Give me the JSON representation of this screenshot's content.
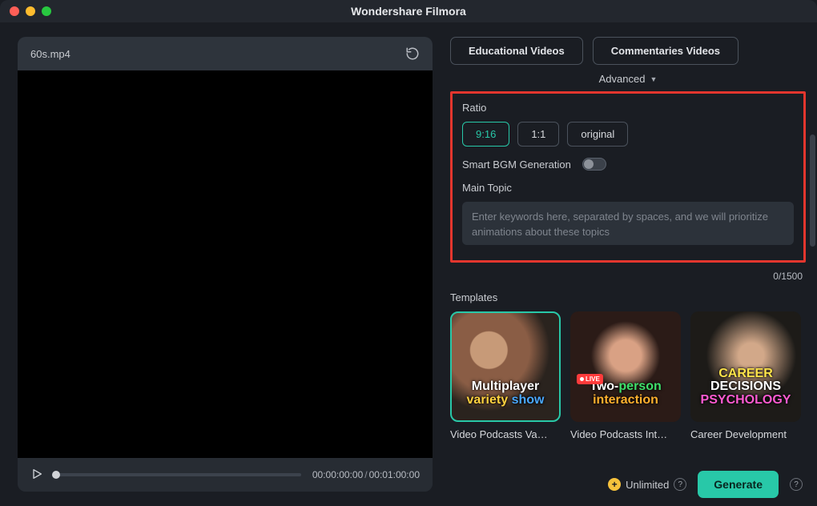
{
  "app": {
    "title": "Wondershare Filmora"
  },
  "video": {
    "filename": "60s.mp4",
    "current_time": "00:00:00:00",
    "total_time": "00:01:00:00"
  },
  "chips": {
    "educational": "Educational Videos",
    "commentaries": "Commentaries Videos"
  },
  "advanced_label": "Advanced",
  "ratio": {
    "label": "Ratio",
    "opt_916": "9:16",
    "opt_11": "1:1",
    "opt_orig": "original",
    "active": "9:16"
  },
  "smart_bgm": {
    "label": "Smart BGM Generation",
    "enabled": false
  },
  "main_topic": {
    "label": "Main Topic",
    "placeholder": "Enter keywords here, separated by spaces, and we will prioritize animations about these topics",
    "value": "",
    "counter": "0/1500"
  },
  "templates": {
    "label": "Templates",
    "items": [
      {
        "name": "Video Podcasts Va…",
        "overlay_line1": "Multiplayer",
        "overlay_line2a": "variety",
        "overlay_line2b": "show",
        "active": true
      },
      {
        "name": "Video Podcasts Int…",
        "overlay_line1a": "Two-",
        "overlay_line1b": "person",
        "overlay_line2": "interaction",
        "badge": "LIVE"
      },
      {
        "name": "Career Development",
        "overlay_line1a": "CAREER",
        "overlay_line1b": "DECISIONS",
        "overlay_line2": "PSYCHOLOGY"
      }
    ]
  },
  "footer": {
    "unlimited": "Unlimited",
    "generate": "Generate"
  }
}
